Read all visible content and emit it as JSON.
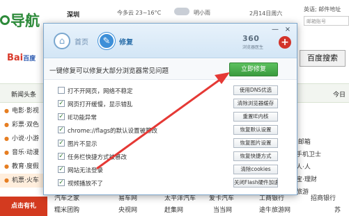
{
  "background": {
    "logo": "导航",
    "city": "深圳",
    "weather_today": "今多云 23~16°C",
    "weather_tomorrow": "明小雨",
    "date": "2月14日周六",
    "mail_label": "邮箱:",
    "mail_user": "英语; 邮件地址",
    "mail_placeholder": "邮箱账号",
    "baidu_brand": "Bai",
    "baidu_suffix": "百度",
    "search_button": "百度搜索",
    "nav": [
      "新闻头条",
      "今日"
    ],
    "sidebar": [
      "电影·影视",
      "彩票·双色",
      "小说·小游",
      "音乐·动漫",
      "教育·度假",
      "机票·火车"
    ],
    "right_col": [
      "·邮箱",
      "手机卫士",
      "人·人",
      "宝·理财",
      "旅游",
      "·游"
    ],
    "right_col2": [
      "凤",
      "人人",
      "凤",
      "天"
    ],
    "bottom_rows": [
      [
        "汽车之家",
        "易车网",
        "太平洋汽车",
        "爱卡汽车",
        "工商银行",
        "招商银行"
      ],
      [
        "糯米团购",
        "央视网",
        "赶集网",
        "当当网",
        "途牛旅游网",
        "苏"
      ]
    ],
    "banner": "点击有礼"
  },
  "dialog": {
    "tabs": [
      {
        "label": "首页",
        "icon": "home-icon"
      },
      {
        "label": "修复",
        "icon": "wrench-icon"
      }
    ],
    "window_buttons": {
      "minimize": "—",
      "close": "×"
    },
    "brand": {
      "number": "360",
      "subtitle": "浏览器医生",
      "icon": "plus-shield-icon"
    },
    "description": "一键修复可以修复大部分浏览器常见问题",
    "fix_button": "立即修复",
    "items": [
      {
        "label": "打不开网页，网络不稳定",
        "checked": false,
        "action": "使用DNS优选"
      },
      {
        "label": "网页打开缓慢，显示错乱",
        "checked": true,
        "action": "清除浏览器缓存"
      },
      {
        "label": "IE功能异常",
        "checked": true,
        "action": "重置IE内核"
      },
      {
        "label": "chrome://flags的默认设置被篡改",
        "checked": true,
        "action": "恢复默认设置"
      },
      {
        "label": "图片不显示",
        "checked": true,
        "action": "恢复图片设置"
      },
      {
        "label": "任务栏快捷方式被篡改",
        "checked": true,
        "action": "恢复快捷方式"
      },
      {
        "label": "网站无法登录",
        "checked": true,
        "action": "清除cookies"
      },
      {
        "label": "视频播放不了",
        "checked": true,
        "action": "关闭Flash硬件加速"
      }
    ]
  },
  "colors": {
    "accent": "#3d8fd8",
    "fix_button": "#4caf50",
    "arrow": "#e53935"
  }
}
